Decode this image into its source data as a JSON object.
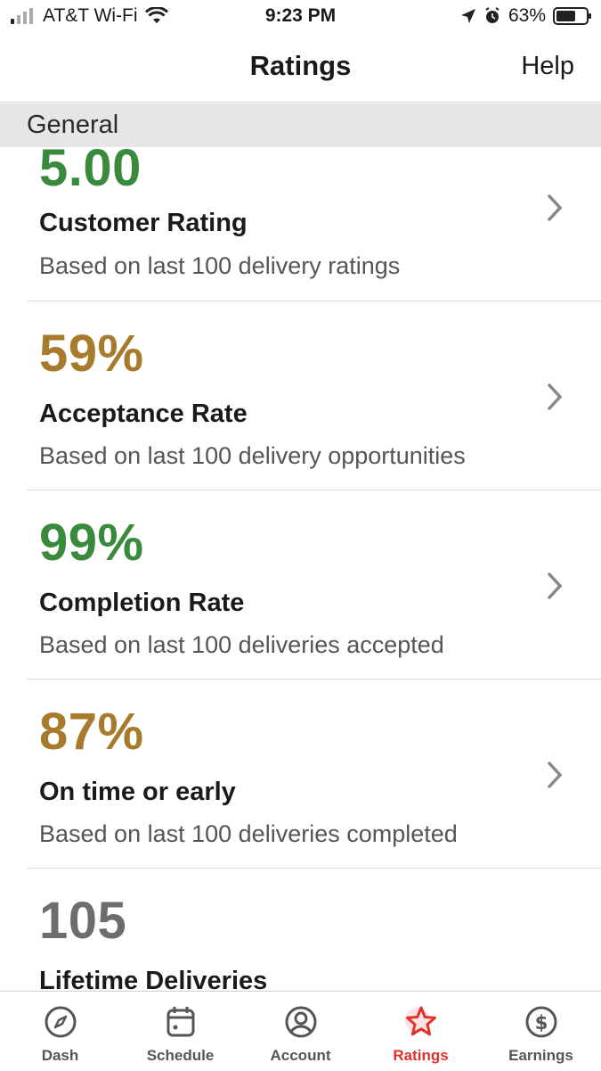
{
  "status_bar": {
    "carrier": "AT&T Wi-Fi",
    "time": "9:23 PM",
    "battery": "63%"
  },
  "nav": {
    "title": "Ratings",
    "help_label": "Help"
  },
  "section": {
    "title": "General"
  },
  "metrics": [
    {
      "value": "5.00",
      "label": "Customer Rating",
      "sub": "Based on last 100 delivery ratings",
      "color": "#3a8a3e"
    },
    {
      "value": "59%",
      "label": "Acceptance Rate",
      "sub": "Based on last 100 delivery opportunities",
      "color": "#a87a2b"
    },
    {
      "value": "99%",
      "label": "Completion Rate",
      "sub": "Based on last 100 deliveries accepted",
      "color": "#3a8a3e"
    },
    {
      "value": "87%",
      "label": "On time or early",
      "sub": "Based on last 100 deliveries completed",
      "color": "#a87a2b"
    },
    {
      "value": "105",
      "label": "Lifetime Deliveries",
      "color": "#6d6d6d"
    }
  ],
  "tabs": [
    {
      "label": "Dash",
      "icon": "compass-icon"
    },
    {
      "label": "Schedule",
      "icon": "calendar-icon"
    },
    {
      "label": "Account",
      "icon": "account-icon"
    },
    {
      "label": "Ratings",
      "icon": "star-icon",
      "active": true
    },
    {
      "label": "Earnings",
      "icon": "dollar-icon"
    }
  ],
  "colors": {
    "accent_active_tab": "#e0322a",
    "inactive_tab": "#555555"
  }
}
